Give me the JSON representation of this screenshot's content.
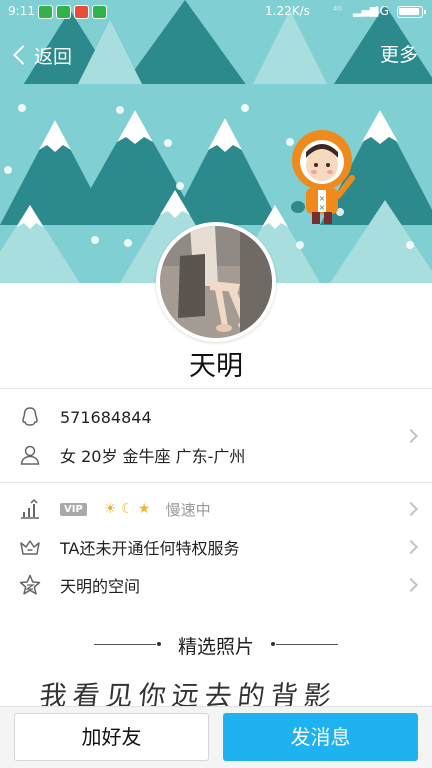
{
  "status_bar": {
    "time": "9:11",
    "speed": "1.22K/s",
    "signal_1": "⁴⁰",
    "signal_2": "▂▄▆",
    "network": "4G"
  },
  "nav": {
    "back_label": "返回",
    "more_label": "更多"
  },
  "profile": {
    "name": "天明",
    "qq_number": "571684844",
    "details": "女  20岁  金牛座  广东-广州"
  },
  "privileges": {
    "vip_badge": "VIP",
    "level_icons": [
      "☀",
      "☾",
      "★"
    ],
    "speed_status": "慢速中",
    "service_text": "TA还未开通任何特权服务",
    "space_text": "天明的空间"
  },
  "photos": {
    "section_title": "精选照片",
    "photo_caption": "我看见你远去的背影"
  },
  "actions": {
    "add_friend": "加好友",
    "send_message": "发消息"
  },
  "colors": {
    "cover_bg": "#7fcfd3",
    "tree_dark": "#2c8a8d",
    "tree_light": "#a9dede",
    "send_button": "#1fb2f1"
  }
}
